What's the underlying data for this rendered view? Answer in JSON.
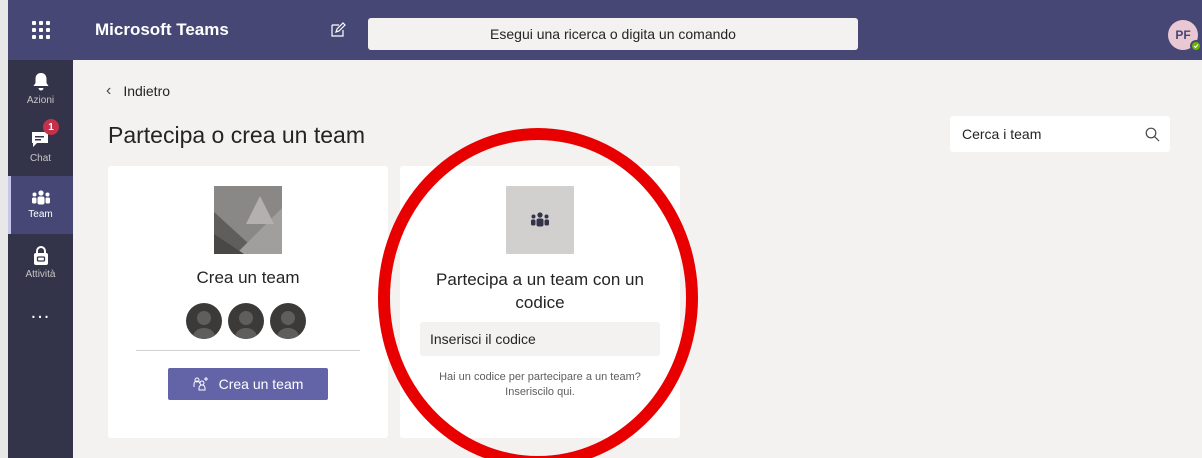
{
  "app": {
    "title": "Microsoft Teams",
    "avatar_initials": "PF"
  },
  "search": {
    "placeholder": "Esegui una ricerca o digita un comando"
  },
  "rail": {
    "items": [
      {
        "label": "Azioni",
        "icon": "bell-icon"
      },
      {
        "label": "Chat",
        "icon": "chat-icon",
        "badge": "1"
      },
      {
        "label": "Team",
        "icon": "teams-icon",
        "active": true
      },
      {
        "label": "Attività",
        "icon": "bag-icon"
      }
    ],
    "more": "..."
  },
  "nav": {
    "back_label": "Indietro"
  },
  "page": {
    "title": "Partecipa o crea un team"
  },
  "team_search": {
    "placeholder": "Cerca i team"
  },
  "create_card": {
    "title": "Crea un team",
    "button_label": "Crea un team"
  },
  "join_card": {
    "title": "Partecipa a un team con un codice",
    "input_placeholder": "Inserisci il codice",
    "hint_line1": "Hai un codice per partecipare a un team?",
    "hint_line2": "Inseriscilo qui."
  },
  "colors": {
    "topbar": "#464775",
    "rail": "#33344a",
    "accent": "#6264a7",
    "annotation": "#e80000"
  }
}
